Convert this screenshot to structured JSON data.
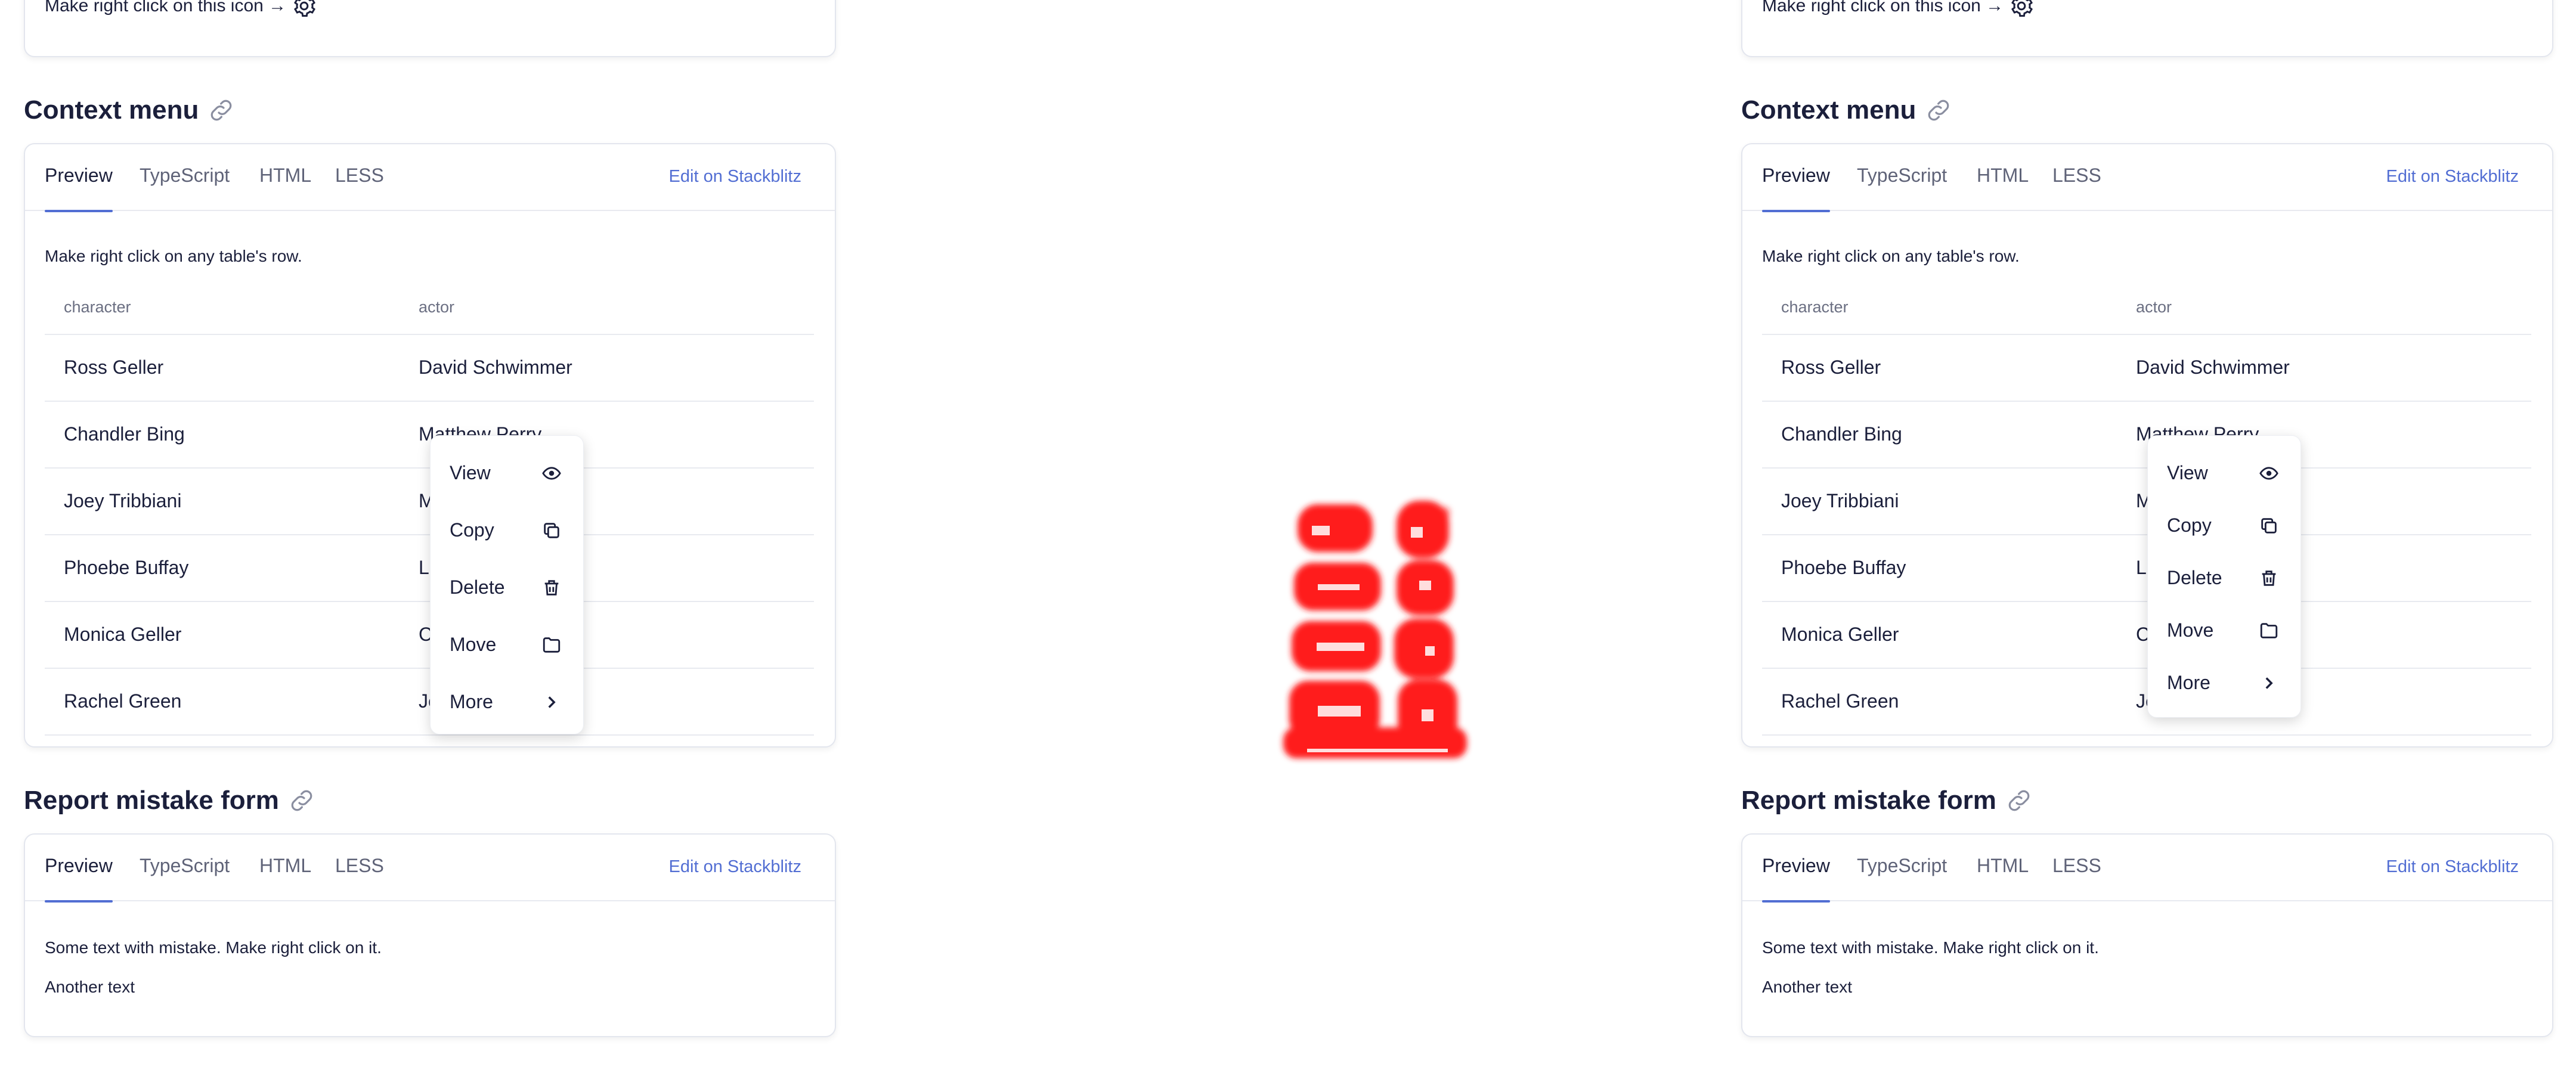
{
  "top_hint": "Make right click on this icon →",
  "sections": {
    "context_title": "Context menu",
    "report_title": "Report mistake form"
  },
  "tabs": [
    "Preview",
    "TypeScript",
    "HTML",
    "LESS"
  ],
  "edit_link": "Edit on Stackblitz",
  "context": {
    "description": "Make right click on any table's row.",
    "columns": [
      "character",
      "actor"
    ],
    "rows": [
      [
        "Ross Geller",
        "David Schwimmer"
      ],
      [
        "Chandler Bing",
        "Matthew Perry"
      ],
      [
        "Joey Tribbiani",
        "M"
      ],
      [
        "Phoebe Buffay",
        "Li"
      ],
      [
        "Monica Geller",
        "C"
      ],
      [
        "Rachel Green",
        "Je"
      ]
    ]
  },
  "menu": {
    "items": [
      {
        "label": "View",
        "icon": "eye-icon"
      },
      {
        "label": "Copy",
        "icon": "copy-icon"
      },
      {
        "label": "Delete",
        "icon": "trash-icon"
      },
      {
        "label": "Move",
        "icon": "folder-icon"
      },
      {
        "label": "More",
        "icon": "chevron-right-icon"
      }
    ]
  },
  "report": {
    "line1": "Some text with mistake. Make right click on it.",
    "line2": "Another text"
  },
  "colors": {
    "accent": "#526ed3",
    "text": "#1b1f3b",
    "center_art": "#ff0000"
  }
}
